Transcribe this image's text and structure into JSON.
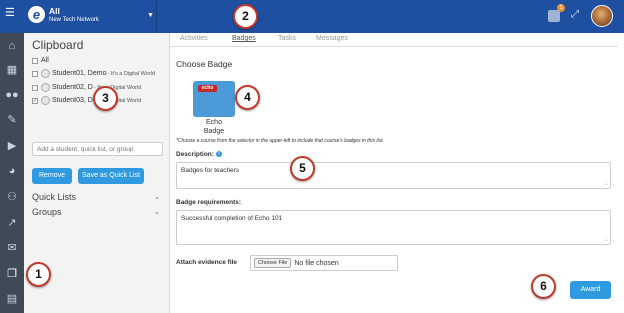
{
  "topbar": {
    "logo_letter": "e",
    "course_name": "All",
    "network_name": "New Tech Network",
    "notification_count": "1",
    "icons": [
      "menu-icon",
      "dropdown-caret-icon",
      "notification-icon",
      "expand-icon",
      "avatar"
    ]
  },
  "iconbar": {
    "items": [
      "home-icon",
      "calendar-icon",
      "people-icon",
      "edit-icon",
      "play-icon",
      "dashboard-icon",
      "accessibility-icon",
      "chart-icon",
      "mail-icon",
      "clipboard-icon",
      "list-icon"
    ],
    "active": "clipboard-icon"
  },
  "clipboard": {
    "title": "Clipboard",
    "all_label": "All",
    "students": [
      {
        "name": "Student01, Demo",
        "org": "- It's a Digital World",
        "checked": false
      },
      {
        "name": "Student02, D",
        "org": "- It's a Digital World",
        "checked": false
      },
      {
        "name": "Student03, D",
        "org": "- It's a Digital World",
        "checked": true
      }
    ],
    "add_placeholder": "Add a student, quick list, or group",
    "remove_label": "Remove",
    "save_quicklist_label": "Save as Quick List",
    "quick_lists_label": "Quick Lists",
    "groups_label": "Groups"
  },
  "tabs": [
    {
      "label": "Activities",
      "active": false
    },
    {
      "label": "Badges",
      "active": true
    },
    {
      "label": "Tasks",
      "active": false
    },
    {
      "label": "Messages",
      "active": false
    }
  ],
  "badge_form": {
    "heading": "Choose Badge",
    "badge_logo_text": "echo",
    "badge_name_line1": "Echo",
    "badge_name_line2": "Badge",
    "hint": "*Choose a course from the selector in the upper-left to include that course's badges in this list.",
    "description_label": "Description:",
    "description_value": "Badges for teachers",
    "requirements_label": "Badge requirements:",
    "requirements_value": "Successful completion of  Echo 101",
    "evidence_label": "Attach evidence file",
    "choose_file_label": "Choose File",
    "no_file_text": "No file chosen",
    "award_label": "Award"
  },
  "callouts": [
    "1",
    "2",
    "3",
    "4",
    "5",
    "6"
  ],
  "colors": {
    "topbar": "#1f4fa0",
    "iconbar": "#3f4a56",
    "button": "#2f9ae0",
    "callout_border": "#c0392b"
  }
}
